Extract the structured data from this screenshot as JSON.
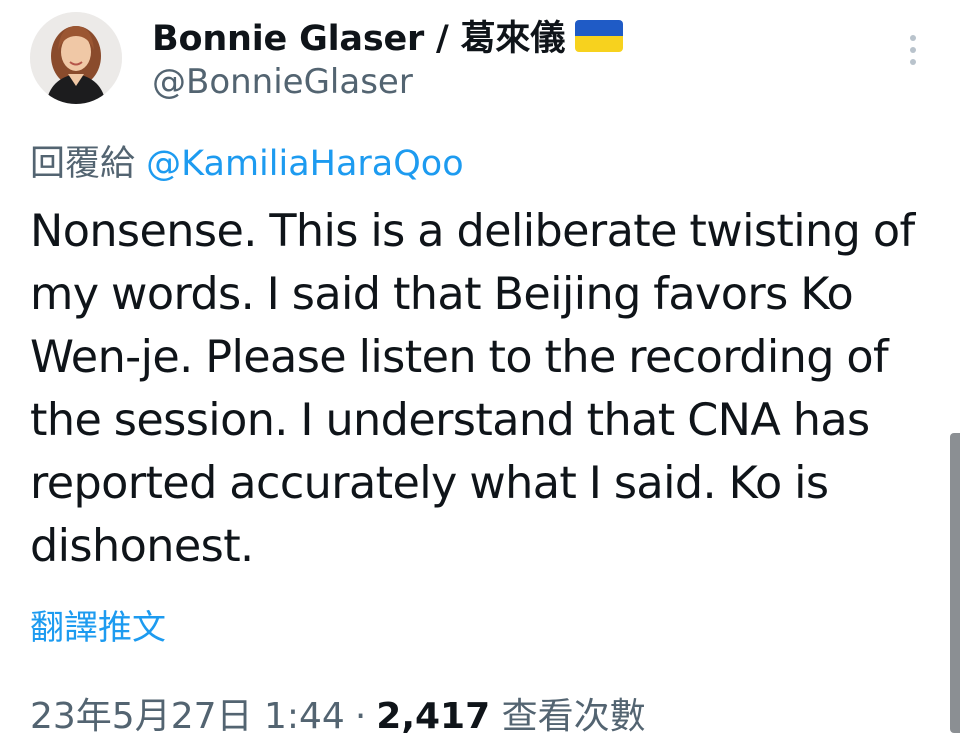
{
  "author": {
    "display_name": "Bonnie Glaser / 葛來儀",
    "handle": "@BonnieGlaser",
    "flag_icon": "ukraine-flag-icon",
    "flag_colors": [
      "#1f5bc6",
      "#f7d21e"
    ]
  },
  "reply": {
    "prefix": "回覆給",
    "to_handle": "@KamiliaHaraQoo"
  },
  "tweet": {
    "text": "Nonsense. This is a deliberate twisting of my words. I said that Beijing favors Ko Wen-je. Please listen to the recording of the session. I understand that CNA has reported accurately what I said. Ko is dishonest."
  },
  "translate_label": "翻譯推文",
  "meta": {
    "timestamp": "23年5月27日 1:44",
    "separator": "·",
    "views_count": "2,417",
    "views_label": "查看次數"
  },
  "colors": {
    "link": "#1d9bf0",
    "secondary_text": "#536471",
    "primary_text": "#0f1419"
  }
}
